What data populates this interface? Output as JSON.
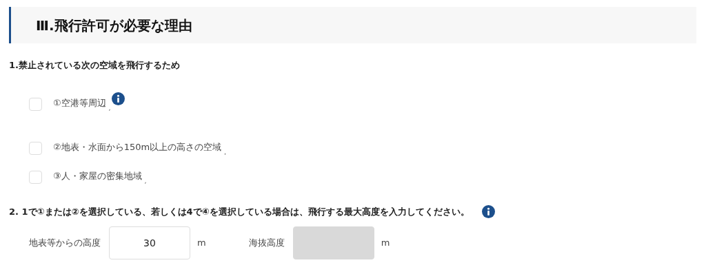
{
  "section": {
    "title": "Ⅲ.飛行許可が必要な理由"
  },
  "question_1": {
    "label": "1.禁止されている次の空域を飛行するため",
    "options": [
      {
        "label": "①空港等周辺",
        "mark": ",",
        "checked": false,
        "info": true
      },
      {
        "label": "②地表・水面から150m以上の高さの空域",
        "mark": ",",
        "checked": false,
        "info": false
      },
      {
        "label": "③人・家屋の密集地域",
        "mark": ",",
        "checked": false,
        "info": false
      }
    ]
  },
  "question_2": {
    "label": "2. 1で①または②を選択している、若しくは4で④を選択している場合は、飛行する最大高度を入力してください。",
    "info": true,
    "fields": [
      {
        "label": "地表等からの高度",
        "value": "30",
        "unit": "m",
        "disabled": false
      },
      {
        "label": "海抜高度",
        "unit": "m",
        "disabled": true
      }
    ]
  }
}
